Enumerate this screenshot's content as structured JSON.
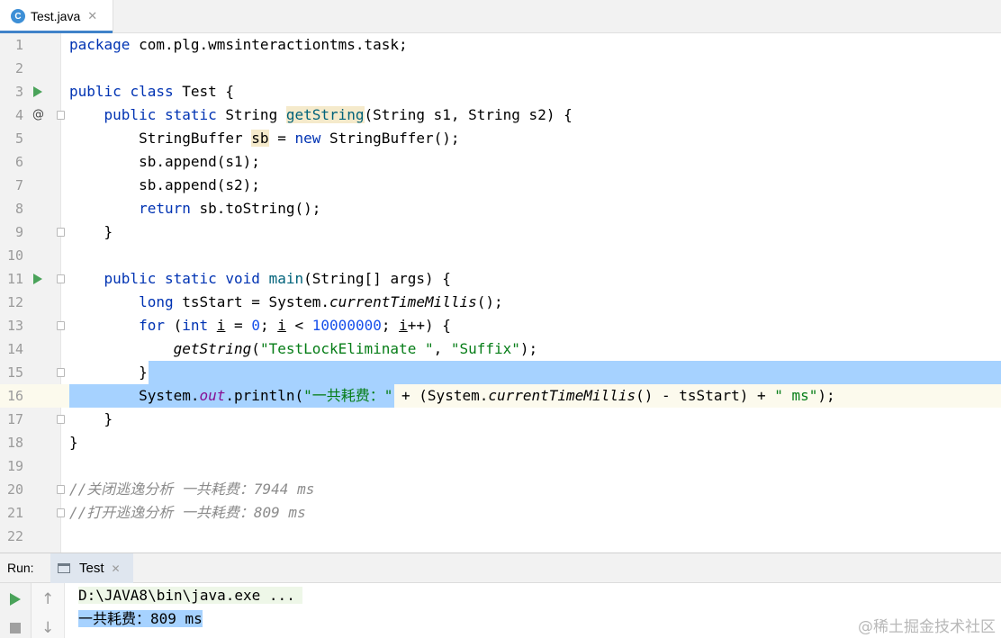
{
  "tab": {
    "icon_letter": "C",
    "label": "Test.java",
    "close": "✕"
  },
  "editor": {
    "lines": [
      {
        "n": "1"
      },
      {
        "n": "2"
      },
      {
        "n": "3"
      },
      {
        "n": "4"
      },
      {
        "n": "5"
      },
      {
        "n": "6"
      },
      {
        "n": "7"
      },
      {
        "n": "8"
      },
      {
        "n": "9"
      },
      {
        "n": "10"
      },
      {
        "n": "11"
      },
      {
        "n": "12"
      },
      {
        "n": "13"
      },
      {
        "n": "14"
      },
      {
        "n": "15"
      },
      {
        "n": "16"
      },
      {
        "n": "17"
      },
      {
        "n": "18"
      },
      {
        "n": "19"
      },
      {
        "n": "20"
      },
      {
        "n": "21"
      },
      {
        "n": "22"
      }
    ],
    "override_marker": "@",
    "code": {
      "l1_kw": "package",
      "l1_rest": " com.plg.wmsinteractiontms.task;",
      "l3_kw1": "public",
      "l3_kw2": "class",
      "l3_rest": " Test {",
      "l4_kw1": "public",
      "l4_kw2": "static",
      "l4_type": " String ",
      "l4_fn": "getString",
      "l4_rest": "(String s1, String s2) {",
      "l5_a": "StringBuffer ",
      "l5_var": "sb",
      "l5_b": " = ",
      "l5_kw": "new",
      "l5_c": " StringBuffer();",
      "l6": "sb.append(s1);",
      "l7": "sb.append(s2);",
      "l8_kw": "return",
      "l8_rest": " sb.toString();",
      "l9": "}",
      "l11_kw1": "public",
      "l11_kw2": "static",
      "l11_kw3": "void",
      "l11_fn": "main",
      "l11_rest": "(String[] args) {",
      "l12_kw": "long",
      "l12_a": " tsStart = System.",
      "l12_it": "currentTimeMillis",
      "l12_b": "();",
      "l13_kw1": "for",
      "l13_a": " (",
      "l13_kw2": "int",
      "l13_b": " ",
      "l13_i1": "i",
      "l13_c": " = ",
      "l13_n0": "0",
      "l13_d": "; ",
      "l13_i2": "i",
      "l13_e": " < ",
      "l13_n1": "10000000",
      "l13_f": "; ",
      "l13_i3": "i",
      "l13_g": "++) {",
      "l14_it": "getString",
      "l14_a": "(",
      "l14_s1": "\"TestLockEliminate \"",
      "l14_b": ", ",
      "l14_s2": "\"Suffix\"",
      "l14_c": ");",
      "l15": "}",
      "l16_a": "System.",
      "l16_fld": "out",
      "l16_b": ".println(",
      "l16_s1": "\"一共耗费：",
      "l16_s1b": "\"",
      "l16_c": " + (System.",
      "l16_it": "currentTimeMillis",
      "l16_d": "() - tsStart) + ",
      "l16_s2": "\" ms\"",
      "l16_e": ");",
      "l17": "}",
      "l18": "}",
      "l20": "//关闭逃逸分析 一共耗费：7944 ms",
      "l21": "//打开逃逸分析 一共耗费：809 ms"
    }
  },
  "run_panel": {
    "label": "Run:",
    "tab_label": "Test",
    "tab_close": "✕",
    "up_arrow": "↑",
    "down_arrow": "↓",
    "console_lines": [
      "D:\\JAVA8\\bin\\java.exe ...",
      "一共耗费：809 ms"
    ]
  },
  "watermark": "@稀土掘金技术社区",
  "colors": {
    "keyword": "#0033b3",
    "string": "#067d17",
    "number": "#1750eb",
    "selection": "#a6d2ff",
    "run_green": "#4aa35a"
  }
}
